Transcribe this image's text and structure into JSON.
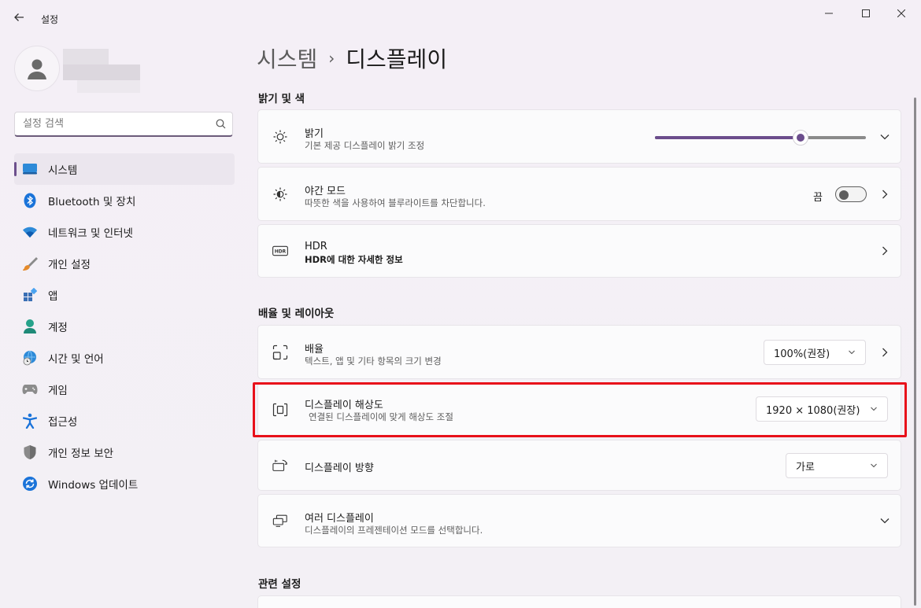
{
  "window": {
    "title": "설정",
    "controls": [
      "minimize-icon",
      "maximize-icon",
      "close-icon"
    ]
  },
  "sidebar": {
    "search_placeholder": "설정 검색",
    "items": [
      {
        "label": "시스템",
        "icon": "system-display-icon",
        "active": true
      },
      {
        "label": "Bluetooth 및 장치",
        "icon": "bluetooth-icon",
        "active": false
      },
      {
        "label": "네트워크 및 인터넷",
        "icon": "wifi-icon",
        "active": false
      },
      {
        "label": "개인 설정",
        "icon": "brush-icon",
        "active": false
      },
      {
        "label": "앱",
        "icon": "apps-icon",
        "active": false
      },
      {
        "label": "계정",
        "icon": "account-icon",
        "active": false
      },
      {
        "label": "시간 및 언어",
        "icon": "globe-clock-icon",
        "active": false
      },
      {
        "label": "게임",
        "icon": "gamepad-icon",
        "active": false
      },
      {
        "label": "접근성",
        "icon": "accessibility-icon",
        "active": false
      },
      {
        "label": "개인 정보 보안",
        "icon": "shield-icon",
        "active": false
      },
      {
        "label": "Windows 업데이트",
        "icon": "update-icon",
        "active": false
      }
    ]
  },
  "breadcrumb": {
    "parent": "시스템",
    "separator": "›",
    "current": "디스플레이"
  },
  "sections": {
    "brightness_color": "밝기 및 색",
    "scale_layout": "배율 및 레이아웃",
    "related": "관련 설정"
  },
  "brightness": {
    "title": "밝기",
    "subtitle": "기본 제공 디스플레이 밝기 조정",
    "level": 0.69
  },
  "night_light": {
    "title": "야간 모드",
    "subtitle": "따뜻한 색을 사용하여 블루라이트를 차단합니다.",
    "state_label": "끔"
  },
  "hdr": {
    "title": "HDR",
    "subtitle": "HDR에 대한 자세한 정보"
  },
  "scale": {
    "title": "배율",
    "subtitle": "텍스트, 앱 및 기타 항목의 크기 변경",
    "value": "100%(권장)"
  },
  "resolution": {
    "title": "디스플레이 해상도",
    "subtitle": "연결된 디스플레이에 맞게 해상도 조절",
    "value": "1920 × 1080(권장)"
  },
  "orientation": {
    "title": "디스플레이 방향",
    "value": "가로"
  },
  "multiple_displays": {
    "title": "여러 디스플레이",
    "subtitle": "디스플레이의 프레젠테이션 모드를 선택합니다."
  },
  "colors": {
    "accent": "#6b4d8c",
    "highlight": "#e8101a"
  }
}
